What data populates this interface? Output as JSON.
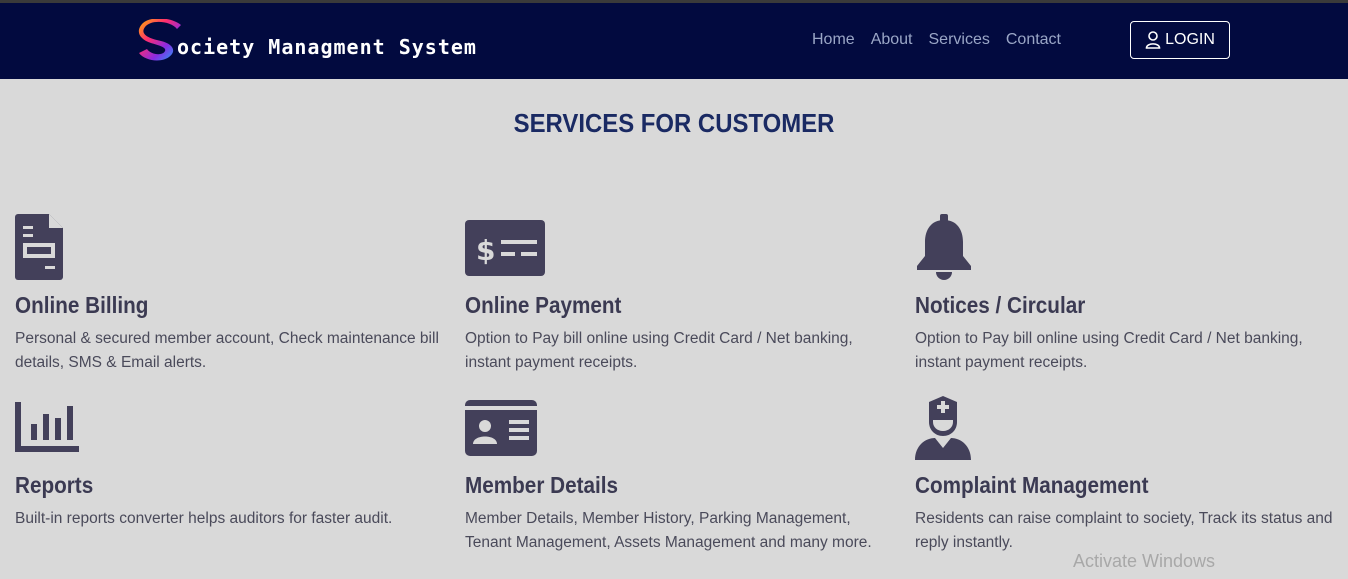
{
  "navbar": {
    "logo_letter": "S",
    "brand_text": "ociety Managment System",
    "links": [
      "Home",
      "About",
      "Services",
      "Contact"
    ],
    "login_label": "LOGIN"
  },
  "main": {
    "title": "SERVICES FOR CUSTOMER",
    "services": [
      {
        "title": "Online Billing",
        "desc": "Personal & secured member account, Check maintenance bill details, SMS & Email alerts.",
        "icon": "bill-document-icon"
      },
      {
        "title": "Online Payment",
        "desc": "Option to Pay bill online using Credit Card / Net banking, instant payment receipts.",
        "icon": "money-check-icon"
      },
      {
        "title": "Notices / Circular",
        "desc": "Option to Pay bill online using Credit Card / Net banking, instant payment receipts.",
        "icon": "bell-icon"
      },
      {
        "title": "Reports",
        "desc": "Built-in reports converter helps auditors for faster audit.",
        "icon": "bar-chart-icon"
      },
      {
        "title": "Member Details",
        "desc": "Member Details, Member History, Parking Management, Tenant Management, Assets Management and many more.",
        "icon": "id-card-icon"
      },
      {
        "title": "Complaint Management",
        "desc": "Residents can raise complaint to society, Track its status and reply instantly.",
        "icon": "user-nurse-icon"
      }
    ]
  },
  "watermark": "Activate Windows",
  "colors": {
    "navbar": "#020a3f",
    "background": "#d9d9d9",
    "title": "#1a2a63",
    "icon": "#43405a"
  }
}
